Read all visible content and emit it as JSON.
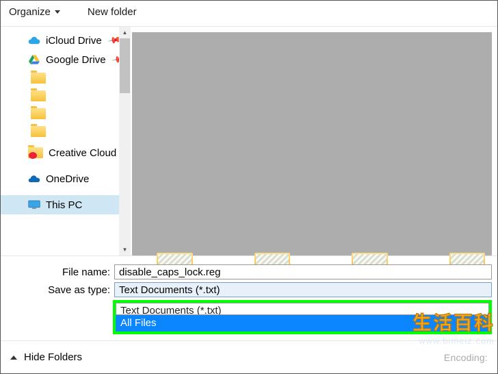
{
  "toolbar": {
    "organize": "Organize",
    "new_folder": "New folder"
  },
  "sidebar": {
    "items": [
      {
        "label": "iCloud Drive",
        "icon": "cloud",
        "pinned": true
      },
      {
        "label": "Google Drive",
        "icon": "gdrive",
        "pinned": true
      },
      {
        "label": "",
        "icon": "folder"
      },
      {
        "label": "",
        "icon": "folder"
      },
      {
        "label": "",
        "icon": "folder"
      },
      {
        "label": "",
        "icon": "folder"
      },
      {
        "label": "Creative Cloud Fil",
        "icon": "cc-folder"
      },
      {
        "label": "OneDrive",
        "icon": "onedrive"
      },
      {
        "label": "This PC",
        "icon": "pc",
        "selected": true
      }
    ]
  },
  "form": {
    "filename_label": "File name:",
    "filename_value": "disable_caps_lock.reg",
    "saveastype_label": "Save as type:",
    "saveastype_value": "Text Documents (*.txt)",
    "dropdown": {
      "partial_above": "Text Documents (*.txt)",
      "selected": "All Files"
    }
  },
  "bottom": {
    "hide_folders": "Hide Folders",
    "encoding_fragment": "Encoding:"
  },
  "watermark": {
    "cn": "生活百科",
    "url": "www.bimeiz.com"
  }
}
